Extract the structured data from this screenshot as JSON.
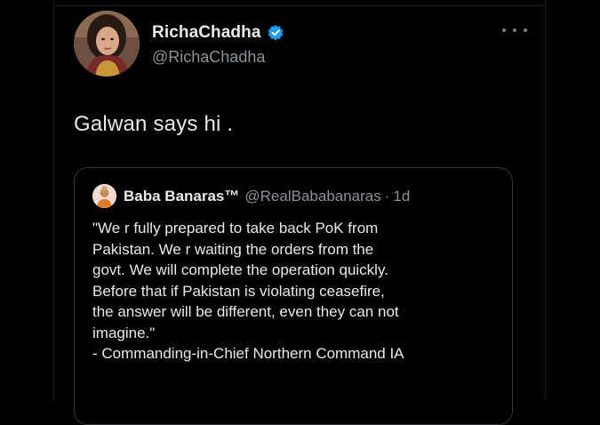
{
  "tweet": {
    "display_name": "RichaChadha",
    "handle": "@RichaChadha",
    "text": "Galwan says hi .",
    "verified_icon": "verified-badge-icon",
    "more_icon": "more-options-icon"
  },
  "quote": {
    "display_name": "Baba Banaras™",
    "handle": "@RealBababanaras",
    "separator": "·",
    "time": "1d",
    "lines": [
      "\"We r fully prepared to take back PoK from",
      "Pakistan. We r waiting the orders from the",
      "govt. We will complete the operation quickly.",
      "Before that if Pakistan is violating ceasefire,",
      "the answer will be different, even they can not",
      "imagine.\"",
      "- Commanding-in-Chief Northern Command IA"
    ]
  },
  "colors": {
    "background": "#000000",
    "text_primary": "#e7e9ea",
    "text_secondary": "#8b9196",
    "verified_blue": "#1d9bf0",
    "quote_border": "#34383c"
  }
}
